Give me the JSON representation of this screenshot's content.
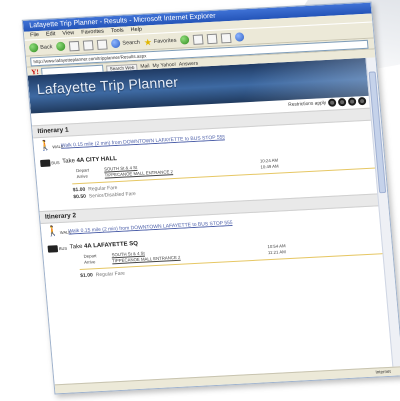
{
  "browser": {
    "title": "Lafayette Trip Planner - Results - Microsoft Internet Explorer",
    "menu": [
      "File",
      "Edit",
      "View",
      "Favorites",
      "Tools",
      "Help"
    ],
    "back_label": "Back",
    "search_label": "Search",
    "favorites_label": "Favorites",
    "address": "http://www.lafayetteplanner.com/tripplanner/Results.aspx",
    "yahoo_logo": "Y!",
    "yahoo_search_btn": "Search Web",
    "yahoo_links": [
      "Mail",
      "My Yahoo!",
      "Answers"
    ],
    "status_text": "Internet"
  },
  "page": {
    "banner_title": "Lafayette Trip Planner",
    "restrictions_label": "Restrictions apply"
  },
  "itineraries": [
    {
      "header": "Itinerary 1",
      "walk_label": "WALK",
      "walk_text": "Walk 0.15 mile (2 min) from DOWNTOWN LAFAYETTE to BUS STOP 555",
      "bus_label": "BUS",
      "take_prefix": "Take",
      "route": "4A CITY HALL",
      "depart_label": "Depart",
      "arrive_label": "Arrive",
      "depart_stop": "SOUTH St & 4 St",
      "arrive_stop": "TIPPECANOE MALL ENTRANCE 2",
      "depart_time": "10:24 AM",
      "arrive_time": "10:49 AM",
      "fares": [
        {
          "price": "$1.00",
          "type": "Regular Fare"
        },
        {
          "price": "$0.50",
          "type": "Senior/Disabled Fare"
        }
      ]
    },
    {
      "header": "Itinerary 2",
      "walk_label": "WALK",
      "walk_text": "Walk 0.15 mile (2 min) from DOWNTOWN LAFAYETTE to BUS STOP 555",
      "bus_label": "BUS",
      "take_prefix": "Take",
      "route": "4A LAFAYETTE SQ",
      "depart_label": "Depart",
      "arrive_label": "Arrive",
      "depart_stop": "SOUTH St & 4 St",
      "arrive_stop": "TIPPECANOE MALL ENTRANCE 2",
      "depart_time": "10:54 AM",
      "arrive_time": "11:21 AM",
      "fares": [
        {
          "price": "$1.00",
          "type": "Regular Fare"
        }
      ]
    }
  ]
}
